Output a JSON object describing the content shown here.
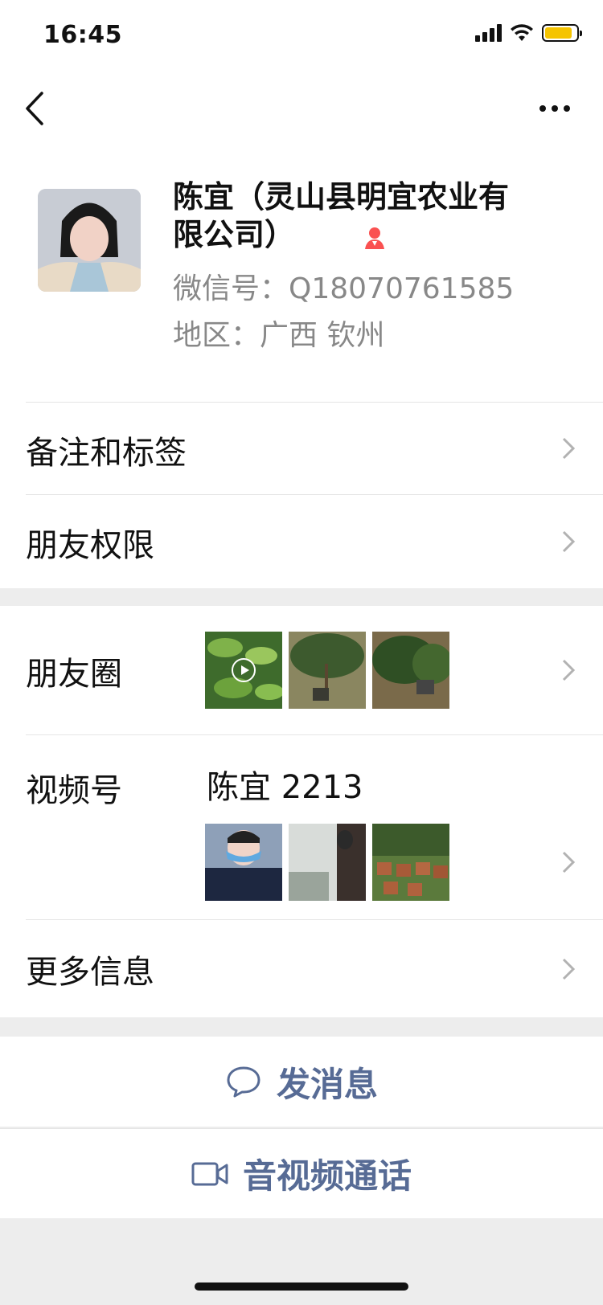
{
  "status_bar": {
    "time": "16:45",
    "battery_color": "#f5c400"
  },
  "nav": {
    "back_icon": "chevron-left-icon",
    "more_icon": "ellipsis-icon"
  },
  "profile": {
    "name": "陈宜（灵山县明宜农业有限公司）",
    "wechat_id": "微信号：Q18070761585",
    "region": "地区：广西 钦州",
    "gender_icon": "female-icon",
    "gender_color": "#fa5151"
  },
  "menu": {
    "remarks_label": "备注和标签",
    "permissions_label": "朋友权限",
    "moments_label": "朋友圈",
    "channels_label": "视频号",
    "channel_name": "陈宜 2213",
    "more_info_label": "更多信息"
  },
  "actions": {
    "message_label": "发消息",
    "call_label": "音视频通话",
    "accent_color": "#576b95"
  }
}
